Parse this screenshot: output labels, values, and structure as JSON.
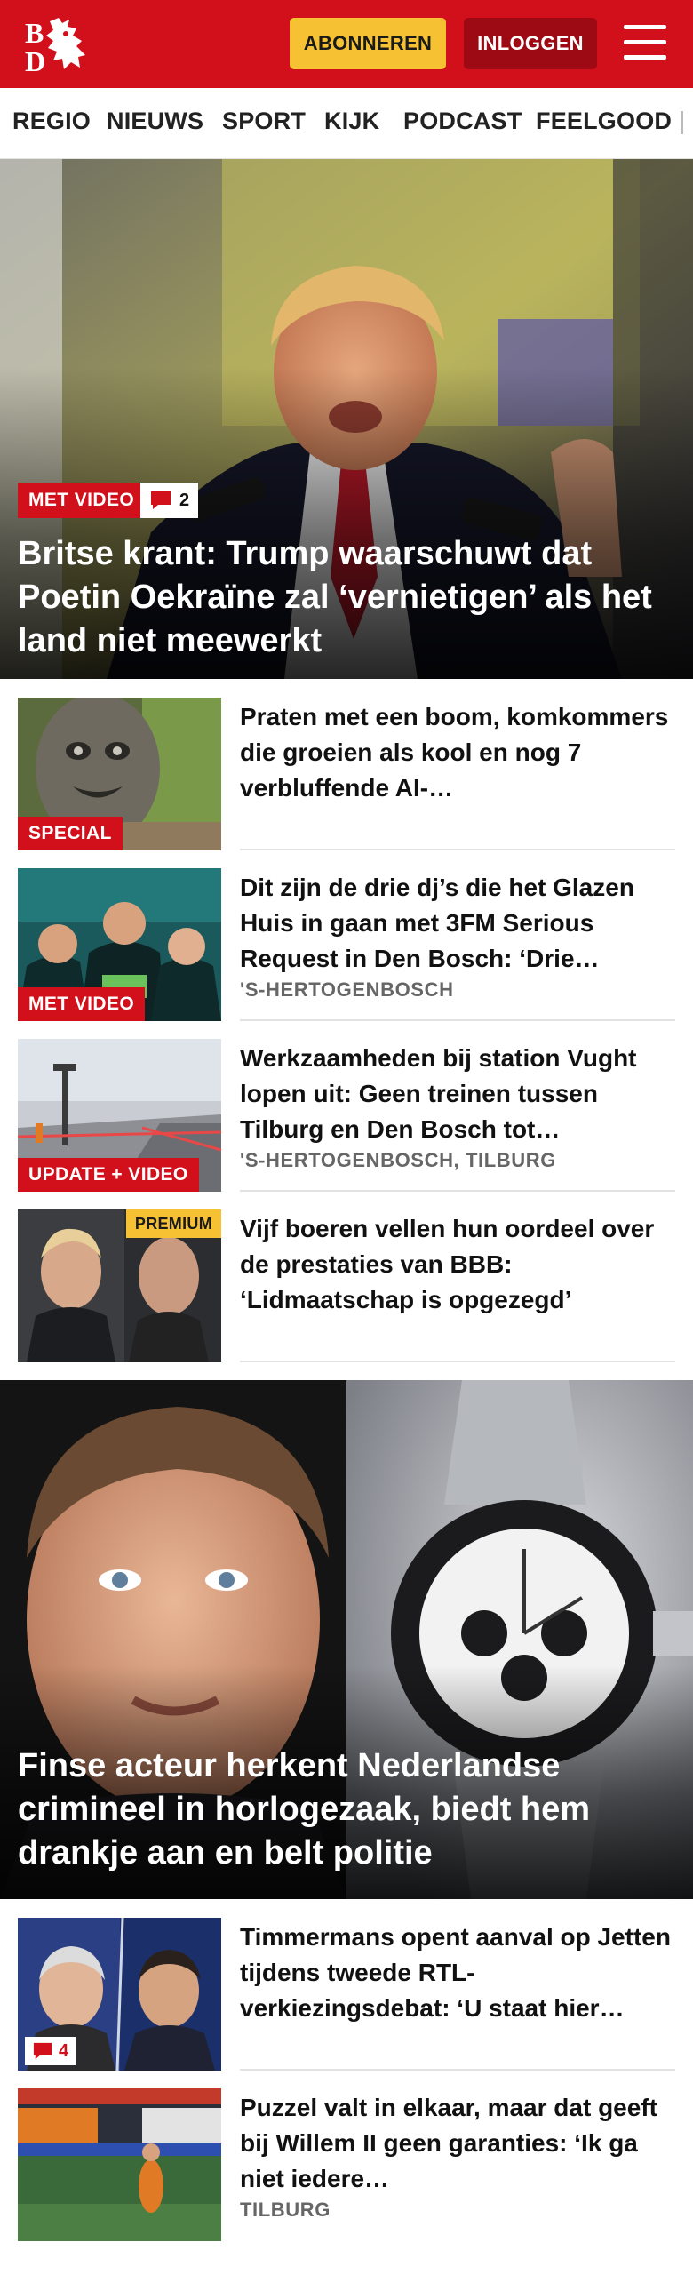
{
  "header": {
    "subscribe_label": "ABONNEREN",
    "login_label": "INLOGGEN",
    "brand_color": "#d1101b",
    "subscribe_color": "#f6c233"
  },
  "nav": {
    "items": [
      "REGIO",
      "NIEUWS",
      "SPORT",
      "KIJK",
      "PODCAST",
      "FEELGOOD"
    ]
  },
  "hero1": {
    "badge": "MET VIDEO",
    "comments": "2",
    "title": "Britse krant: Trump waarschuwt dat Poetin Oekraïne zal ‘vernietigen’ als het land niet meewerkt"
  },
  "articles1": [
    {
      "badge": "SPECIAL",
      "title": "Praten met een boom, komkommers die groeien als kool en nog 7 verbluffende AI-…",
      "location": ""
    },
    {
      "badge": "MET VIDEO",
      "title": "Dit zijn de drie dj’s die het Glazen Huis in gaan met 3FM Serious Request in Den Bosch: ‘Drie…",
      "location": "'S-HERTOGENBOSCH"
    },
    {
      "badge": "UPDATE + VIDEO",
      "title": "Werkzaamheden bij station Vught lopen uit: Geen treinen tussen Tilburg en Den Bosch tot…",
      "location": "'S-HERTOGENBOSCH, TILBURG"
    },
    {
      "badge": "PREMIUM",
      "title": "Vijf boeren vellen hun oordeel over de prestaties van BBB: ‘Lidmaatschap is opgezegd’",
      "location": ""
    }
  ],
  "hero2": {
    "title": "Finse acteur herkent Nederlandse crimineel in horlogezaak, biedt hem drankje aan en belt politie"
  },
  "articles2": [
    {
      "comments": "4",
      "title": "Timmermans opent aanval op Jetten tijdens tweede RTL-verkiezingsdebat: ‘U staat hier…",
      "location": ""
    },
    {
      "title": "Puzzel valt in elkaar, maar dat geeft bij Willem II geen garanties: ‘Ik ga niet iedere…",
      "location": "TILBURG"
    }
  ],
  "icons": {
    "logo": "bd-logo",
    "menu": "hamburger-icon",
    "comment": "comment-icon"
  }
}
